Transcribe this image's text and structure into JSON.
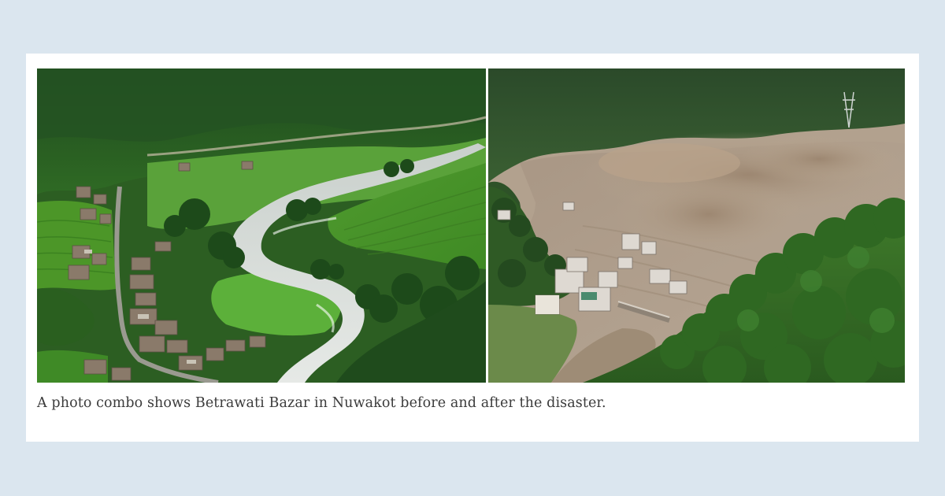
{
  "figure": {
    "photos": [
      {
        "icon": "landscape-photo",
        "subject": "before"
      },
      {
        "icon": "landscape-photo",
        "subject": "after"
      }
    ],
    "caption": "A photo combo shows Betrawati Bazar in Nuwakot before and after the disaster."
  }
}
